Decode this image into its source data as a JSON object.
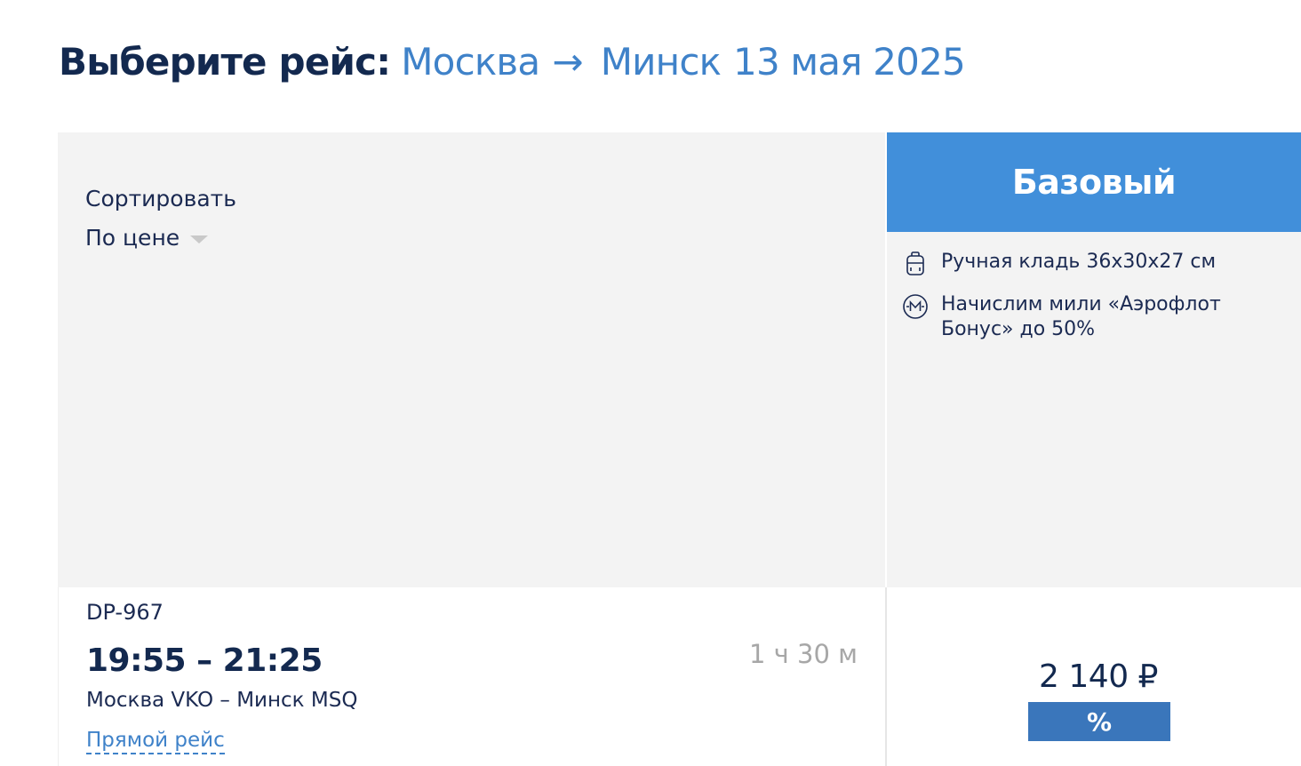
{
  "header": {
    "label": "Выберите рейс:",
    "origin": "Москва",
    "arrow": "→",
    "destination": "Минск",
    "date": "13 мая 2025"
  },
  "sort": {
    "label": "Сортировать",
    "value": "По цене",
    "icon": "chevron-down-icon"
  },
  "fare": {
    "name": "Базовый",
    "features": [
      {
        "icon": "backpack-icon",
        "text": "Ручная кладь 36x30x27 см"
      },
      {
        "icon": "miles-icon",
        "text": "Начислим мили «Аэрофлот Бонус» до 50%"
      }
    ],
    "accent_color": "#418fda"
  },
  "flight": {
    "number": "DP-967",
    "time": "19:55 – 21:25",
    "duration": "1 ч 30 м",
    "airports": "Москва VKO – Минск MSQ",
    "type": "Прямой рейс"
  },
  "price": {
    "amount": "2 140 ₽",
    "badge": "%",
    "badge_color": "#3a76bb"
  }
}
